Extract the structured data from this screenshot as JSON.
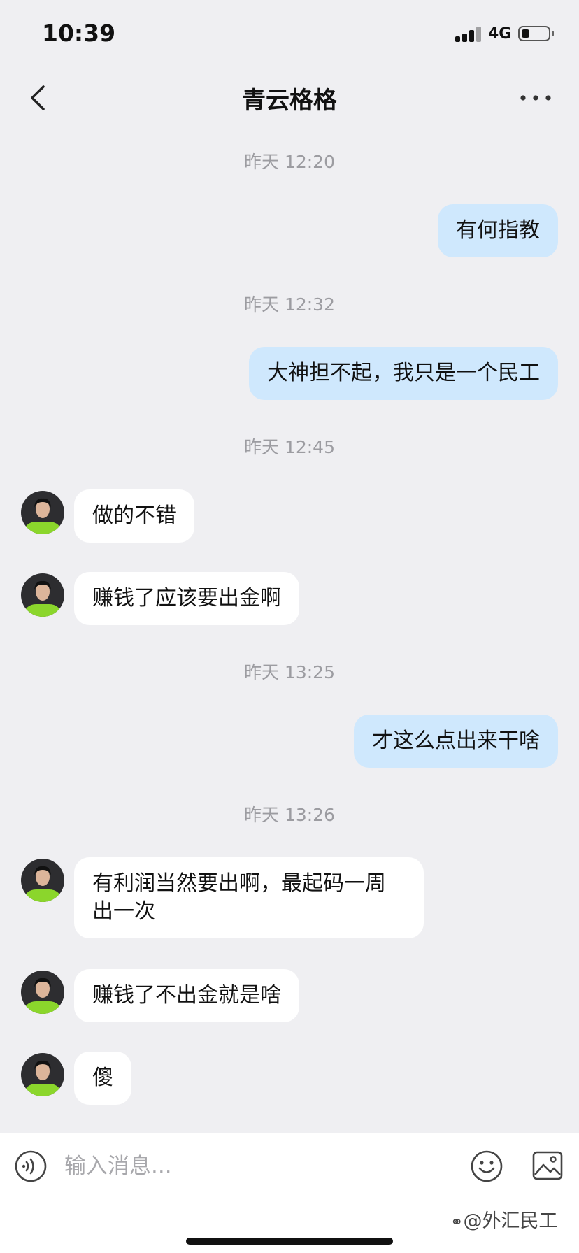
{
  "status_bar": {
    "time": "10:39",
    "network": "4G",
    "battery_level": 0.3
  },
  "header": {
    "title": "青云格格",
    "back_icon": "chevron-left-icon",
    "more_icon": "more-horizontal-icon"
  },
  "messages": [
    {
      "kind": "time",
      "text": "昨天 12:20"
    },
    {
      "kind": "sent",
      "text": "有何指教"
    },
    {
      "kind": "time",
      "text": "昨天 12:32"
    },
    {
      "kind": "sent",
      "text": "大神担不起，我只是一个民工"
    },
    {
      "kind": "time",
      "text": "昨天 12:45"
    },
    {
      "kind": "received",
      "text": "做的不错"
    },
    {
      "kind": "received",
      "text": "赚钱了应该要出金啊"
    },
    {
      "kind": "time",
      "text": "昨天 13:25"
    },
    {
      "kind": "sent",
      "text": "才这么点出来干啥"
    },
    {
      "kind": "time",
      "text": "昨天 13:26"
    },
    {
      "kind": "received",
      "text": "有利润当然要出啊，最起码一周出一次"
    },
    {
      "kind": "received",
      "text": "赚钱了不出金就是啥"
    },
    {
      "kind": "received",
      "text": "傻"
    }
  ],
  "input_bar": {
    "placeholder": "输入消息...",
    "value": "",
    "voice_icon": "voice-icon",
    "emoji_icon": "emoji-icon",
    "image_icon": "image-icon"
  },
  "watermark": "@外汇民工",
  "colors": {
    "background": "#efeff2",
    "sent_bubble": "#cfe8fd",
    "received_bubble": "#ffffff",
    "timestamp_text": "#9c9ca1"
  }
}
